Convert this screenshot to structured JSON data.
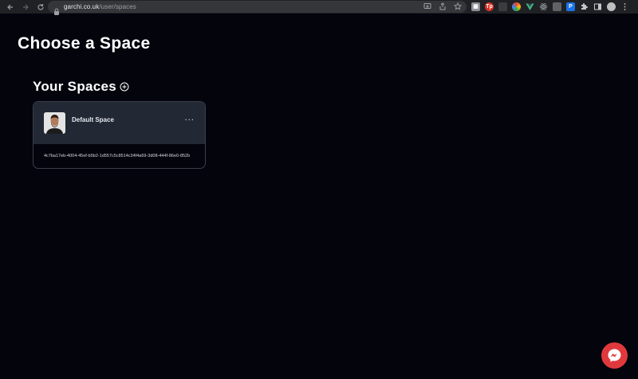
{
  "browser": {
    "url_host": "garchi.co.uk",
    "url_path": "/user/spaces",
    "extensions": [
      {
        "name": "ext-grid",
        "color": "#8a8f98",
        "glyph": "▦"
      },
      {
        "name": "ext-tp",
        "color": "#d93025",
        "glyph": "Tp"
      },
      {
        "name": "ext-dark",
        "color": "#3c3c3c",
        "glyph": ""
      },
      {
        "name": "ext-color",
        "color": "#5f6368",
        "glyph": ""
      },
      {
        "name": "ext-vue",
        "color": "#202124",
        "glyph": ""
      },
      {
        "name": "ext-react",
        "color": "#202124",
        "glyph": ""
      },
      {
        "name": "ext-box",
        "color": "#5f6368",
        "glyph": ""
      },
      {
        "name": "ext-blue",
        "color": "#1a73e8",
        "glyph": "P"
      }
    ]
  },
  "page": {
    "title": "Choose a Space",
    "section_title": "Your Spaces"
  },
  "spaces": [
    {
      "name": "Default Space",
      "id": "4c7ba17eb-4004-45ef-b5b2-1d557c5c8514c34f4a69-3d08-444f-86e0-852b"
    }
  ],
  "colors": {
    "background": "#03040c",
    "card_header": "#222834",
    "messenger": "#e0393d"
  }
}
